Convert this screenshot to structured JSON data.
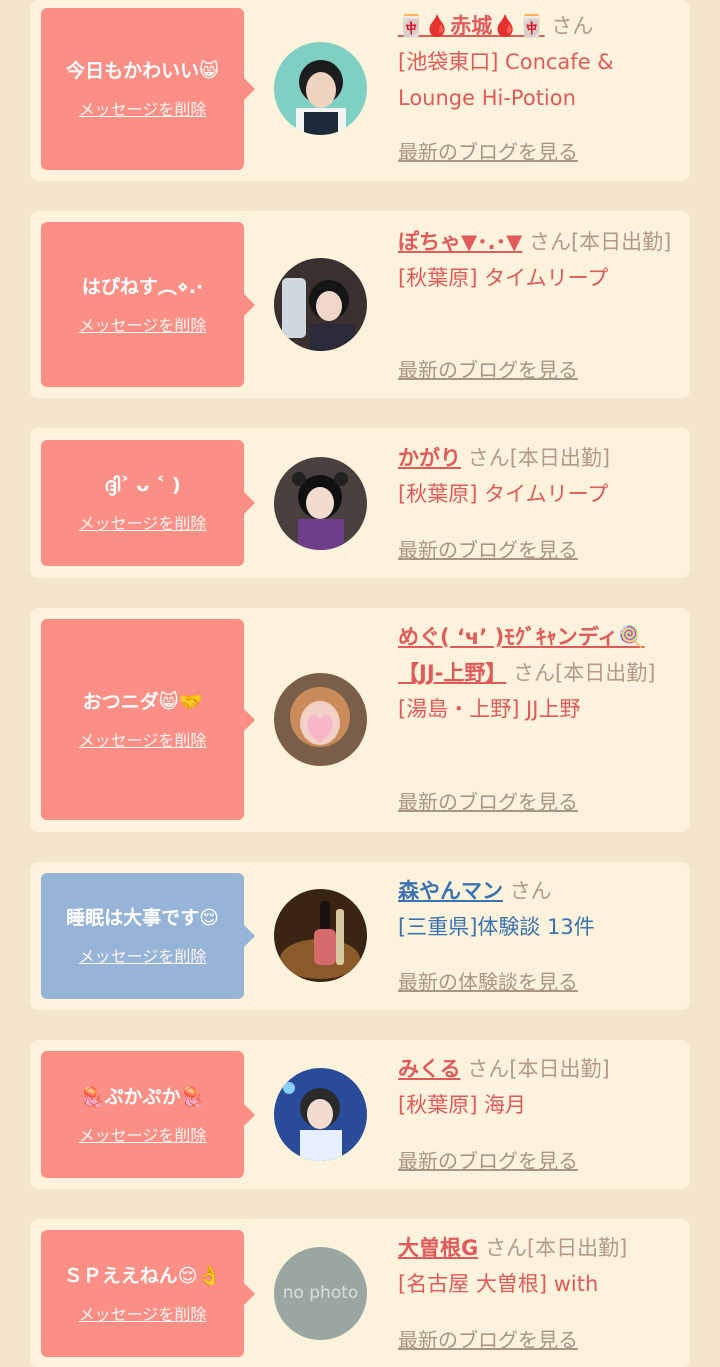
{
  "delete_label": "メッセージを削除",
  "blog_label": "最新のブログを見る",
  "review_label": "最新の体験談を見る",
  "honorific": "さん",
  "entries": [
    {
      "message": "今日もかわいい😸",
      "name": "🀄🩸赤城🩸🀄",
      "status": "",
      "shop": "[池袋東口] Concafe & Lounge Hi-Potion"
    },
    {
      "message": "はぴねす︵⋄.·",
      "name": "ぽちゃ▼･.･▼",
      "status": "[本日出勤]",
      "shop": "[秋葉原] タイムリープ"
    },
    {
      "message": "ദ്ദി˃ ᴗ ˂ )",
      "name": "かがり",
      "status": "[本日出勤]",
      "shop": "[秋葉原] タイムリープ"
    },
    {
      "message": "おつニダ😸🤝",
      "name": "めぐ( ‘ч’ )ﾓｸﾞｷｬンディ🍭【JJ-上野】",
      "status": "[本日出勤]",
      "shop": "[湯島・上野] JJ上野"
    },
    {
      "message": "睡眠は大事です😌",
      "name": "森やんマン",
      "status": "",
      "shop": "[三重県]体験談 13件"
    },
    {
      "message": "🪼ぷかぷか🪼",
      "name": "みくる",
      "status": "[本日出勤]",
      "shop": "[秋葉原] 海月"
    },
    {
      "message": "ＳＰええねん😌👌",
      "name": "大曽根G",
      "status": "[本日出勤]",
      "shop": "[名古屋 大曽根] with"
    }
  ],
  "avatar_placeholder_text": "no photo"
}
